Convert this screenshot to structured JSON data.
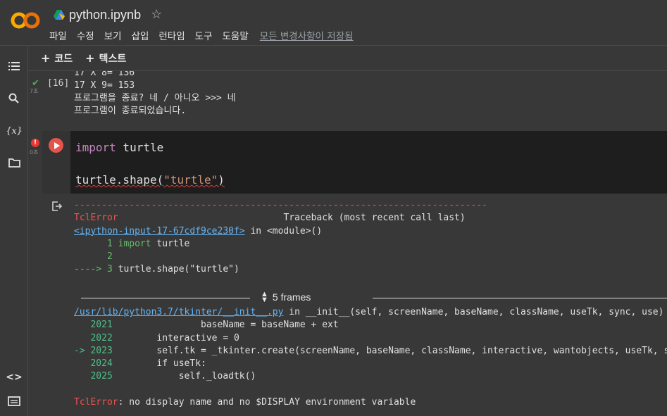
{
  "header": {
    "title": "python.ipynb",
    "menu": [
      "파일",
      "수정",
      "보기",
      "삽입",
      "런타임",
      "도구",
      "도움말"
    ],
    "save_status": "모든 변경사항이 저장됨"
  },
  "toolbar": {
    "add_code": "코드",
    "add_text": "텍스트"
  },
  "prev_cell": {
    "execution_count": "[16]",
    "elapsed": "7초",
    "output_lines": [
      "17 X 8= 136",
      "17 X 9= 153",
      "프로그램을 종료? 네 / 아니오 >>> 네",
      "프로그램이 종료되었습니다."
    ]
  },
  "cell": {
    "elapsed": "0초",
    "code_line1_kw": "import",
    "code_line1_rest": " turtle",
    "code_line3_a": "turtle.shape(",
    "code_line3_str": "\"turtle\"",
    "code_line3_b": ")"
  },
  "traceback": {
    "dashes": "---------------------------------------------------------------------------",
    "error_name": "TclError",
    "header_right": "Traceback (most recent call last)",
    "input_link": "<ipython-input-17-67cdf9ce230f>",
    "input_in": " in <module>()",
    "lines": [
      {
        "prefix": "      1 ",
        "kw": "import",
        "rest": " turtle"
      },
      {
        "prefix": "      2",
        "kw": "",
        "rest": ""
      },
      {
        "prefix": "----> 3 ",
        "kw": "",
        "rest": "turtle.shape(\"turtle\")"
      }
    ],
    "frames_label": "5 frames",
    "file_link": "/usr/lib/python3.7/tkinter/__init__.py",
    "file_in": " in __init__(self, screenName, baseName, className, useTk, sync, use)",
    "frame_lines": [
      {
        "num": "   2021",
        "code": "                baseName = baseName + ext"
      },
      {
        "num": "   2022",
        "code": "        interactive = 0"
      },
      {
        "num": "-> 2023",
        "code": "        self.tk = _tkinter.create(screenName, baseName, className, interactive, wantobjects, useTk, sync, use)"
      },
      {
        "num": "   2024",
        "code": "        if useTk:"
      },
      {
        "num": "   2025",
        "code": "            self._loadtk()"
      }
    ],
    "final_error_name": "TclError",
    "final_error_msg": ": no display name and no $DISPLAY environment variable"
  }
}
